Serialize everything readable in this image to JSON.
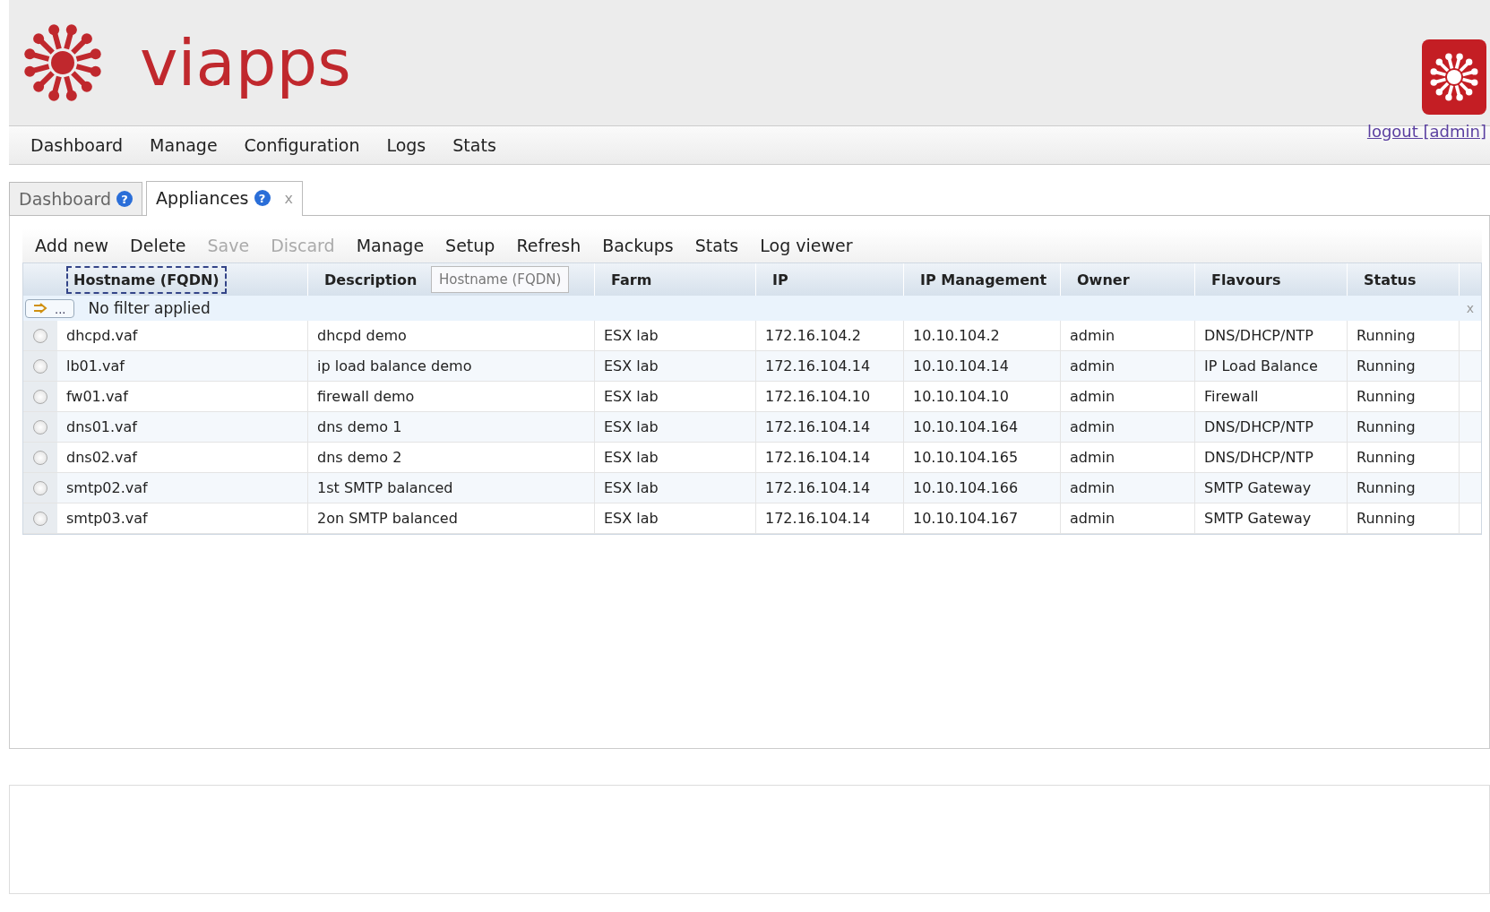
{
  "header": {
    "brand": "viapps",
    "logout_link": "logout [admin]"
  },
  "nav": [
    "Dashboard",
    "Manage",
    "Configuration",
    "Logs",
    "Stats"
  ],
  "tabs": [
    {
      "label": "Dashboard",
      "help_glyph": "?",
      "selected": false,
      "closable": false
    },
    {
      "label": "Appliances",
      "help_glyph": "?",
      "selected": true,
      "closable": true,
      "close_glyph": "x"
    }
  ],
  "toolbar": [
    {
      "label": "Add new",
      "disabled": false
    },
    {
      "label": "Delete",
      "disabled": false
    },
    {
      "label": "Save",
      "disabled": true
    },
    {
      "label": "Discard",
      "disabled": true
    },
    {
      "label": "Manage",
      "disabled": false
    },
    {
      "label": "Setup",
      "disabled": false
    },
    {
      "label": "Refresh",
      "disabled": false
    },
    {
      "label": "Backups",
      "disabled": false
    },
    {
      "label": "Stats",
      "disabled": false
    },
    {
      "label": "Log viewer",
      "disabled": false
    }
  ],
  "table": {
    "columns": [
      {
        "label": "Hostname (FQDN)",
        "focused": true
      },
      {
        "label": "Description",
        "focused": false
      },
      {
        "label": "Farm",
        "focused": false
      },
      {
        "label": "IP",
        "focused": false
      },
      {
        "label": "IP Management",
        "focused": false
      },
      {
        "label": "Owner",
        "focused": false
      },
      {
        "label": "Flavours",
        "focused": false
      },
      {
        "label": "Status",
        "focused": false
      }
    ],
    "drag_ghost": "Hostname (FQDN)",
    "filter": {
      "button_text": "...",
      "text": "No filter applied",
      "clear_glyph": "x"
    },
    "rows": [
      {
        "selected": false,
        "cells": [
          "dhcpd.vaf",
          "dhcpd demo",
          "ESX lab",
          "172.16.104.2",
          "10.10.104.2",
          "admin",
          "DNS/DHCP/NTP",
          "Running"
        ]
      },
      {
        "selected": false,
        "cells": [
          "lb01.vaf",
          "ip load balance demo",
          "ESX lab",
          "172.16.104.14",
          "10.10.104.14",
          "admin",
          "IP Load Balance",
          "Running"
        ]
      },
      {
        "selected": false,
        "cells": [
          "fw01.vaf",
          "firewall demo",
          "ESX lab",
          "172.16.104.10",
          "10.10.104.10",
          "admin",
          "Firewall",
          "Running"
        ]
      },
      {
        "selected": false,
        "cells": [
          "dns01.vaf",
          "dns demo 1",
          "ESX lab",
          "172.16.104.14",
          "10.10.104.164",
          "admin",
          "DNS/DHCP/NTP",
          "Running"
        ]
      },
      {
        "selected": false,
        "cells": [
          "dns02.vaf",
          "dns demo 2",
          "ESX lab",
          "172.16.104.14",
          "10.10.104.165",
          "admin",
          "DNS/DHCP/NTP",
          "Running"
        ]
      },
      {
        "selected": false,
        "cells": [
          "smtp02.vaf",
          "1st SMTP balanced",
          "ESX lab",
          "172.16.104.14",
          "10.10.104.166",
          "admin",
          "SMTP Gateway",
          "Running"
        ]
      },
      {
        "selected": false,
        "cells": [
          "smtp03.vaf",
          "2on SMTP balanced",
          "ESX lab",
          "172.16.104.14",
          "10.10.104.167",
          "admin",
          "SMTP Gateway",
          "Running"
        ]
      }
    ]
  }
}
